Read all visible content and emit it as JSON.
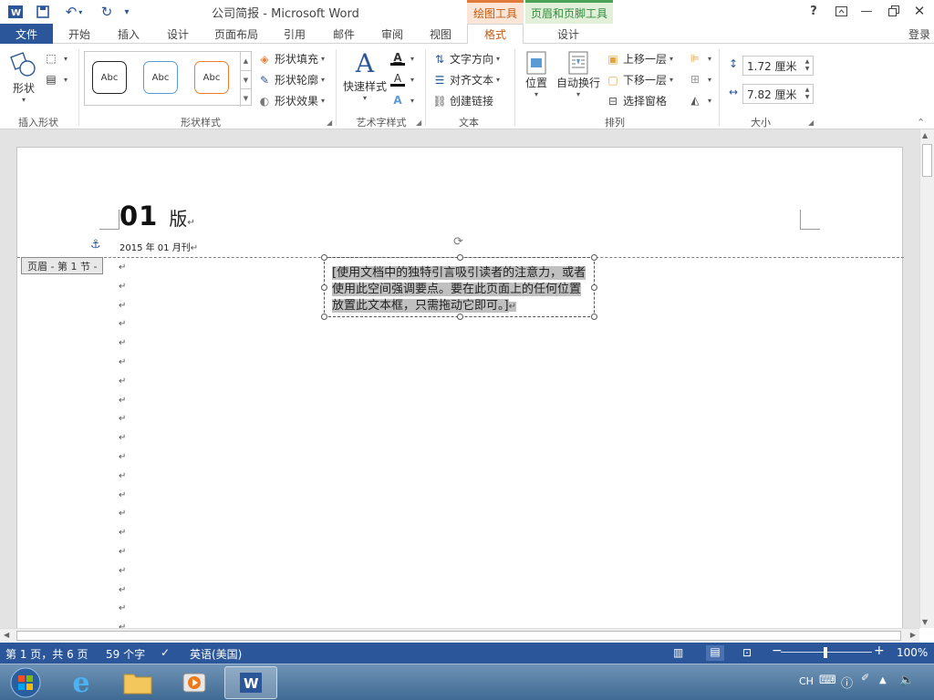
{
  "app": {
    "window_title": "公司简报 - Microsoft Word",
    "context_tabs": {
      "drawing_tools": "绘图工具",
      "header_footer_tools": "页眉和页脚工具"
    },
    "help": "?",
    "login": "登录",
    "colors": {
      "brand": "#2b579a",
      "context_drawing": "#c55a11",
      "context_header": "#2e8b3d"
    }
  },
  "tabs": [
    "文件",
    "开始",
    "插入",
    "设计",
    "页面布局",
    "引用",
    "邮件",
    "审阅",
    "视图",
    "格式",
    "设计"
  ],
  "ribbon": {
    "insert_shapes": {
      "shapes_label": "形状",
      "group_label": "插入形状"
    },
    "shape_styles": {
      "gallery": [
        "Abc",
        "Abc",
        "Abc"
      ],
      "fill": "形状填充",
      "outline": "形状轮廓",
      "effects": "形状效果",
      "group_label": "形状样式"
    },
    "wordart": {
      "quick_styles": "快速样式",
      "group_label": "艺术字样式"
    },
    "text": {
      "direction": "文字方向",
      "align": "对齐文本",
      "link": "创建链接",
      "group_label": "文本"
    },
    "arrange": {
      "position": "位置",
      "wrap": "自动换行",
      "bring_forward": "上移一层",
      "send_backward": "下移一层",
      "selection_pane": "选择窗格",
      "group_label": "排列"
    },
    "size": {
      "height": "1.72 厘米",
      "width": "7.82 厘米",
      "group_label": "大小"
    }
  },
  "document": {
    "header_tab": "页眉 - 第 1 节 -",
    "title_num": "01",
    "title_suffix": "版",
    "date": "2015 年 01 月刊",
    "para_mark": "↵",
    "textbox_text": "[使用文档中的独特引言吸引读者的注意力，或者使用此空间强调要点。要在此页面上的任何位置放置此文本框，只需拖动它即可。]"
  },
  "status": {
    "page": "第 1 页，共 6 页",
    "words": "59 个字",
    "language": "英语(美国)",
    "zoom": "100%"
  },
  "taskbar": {
    "ime": "CH"
  }
}
